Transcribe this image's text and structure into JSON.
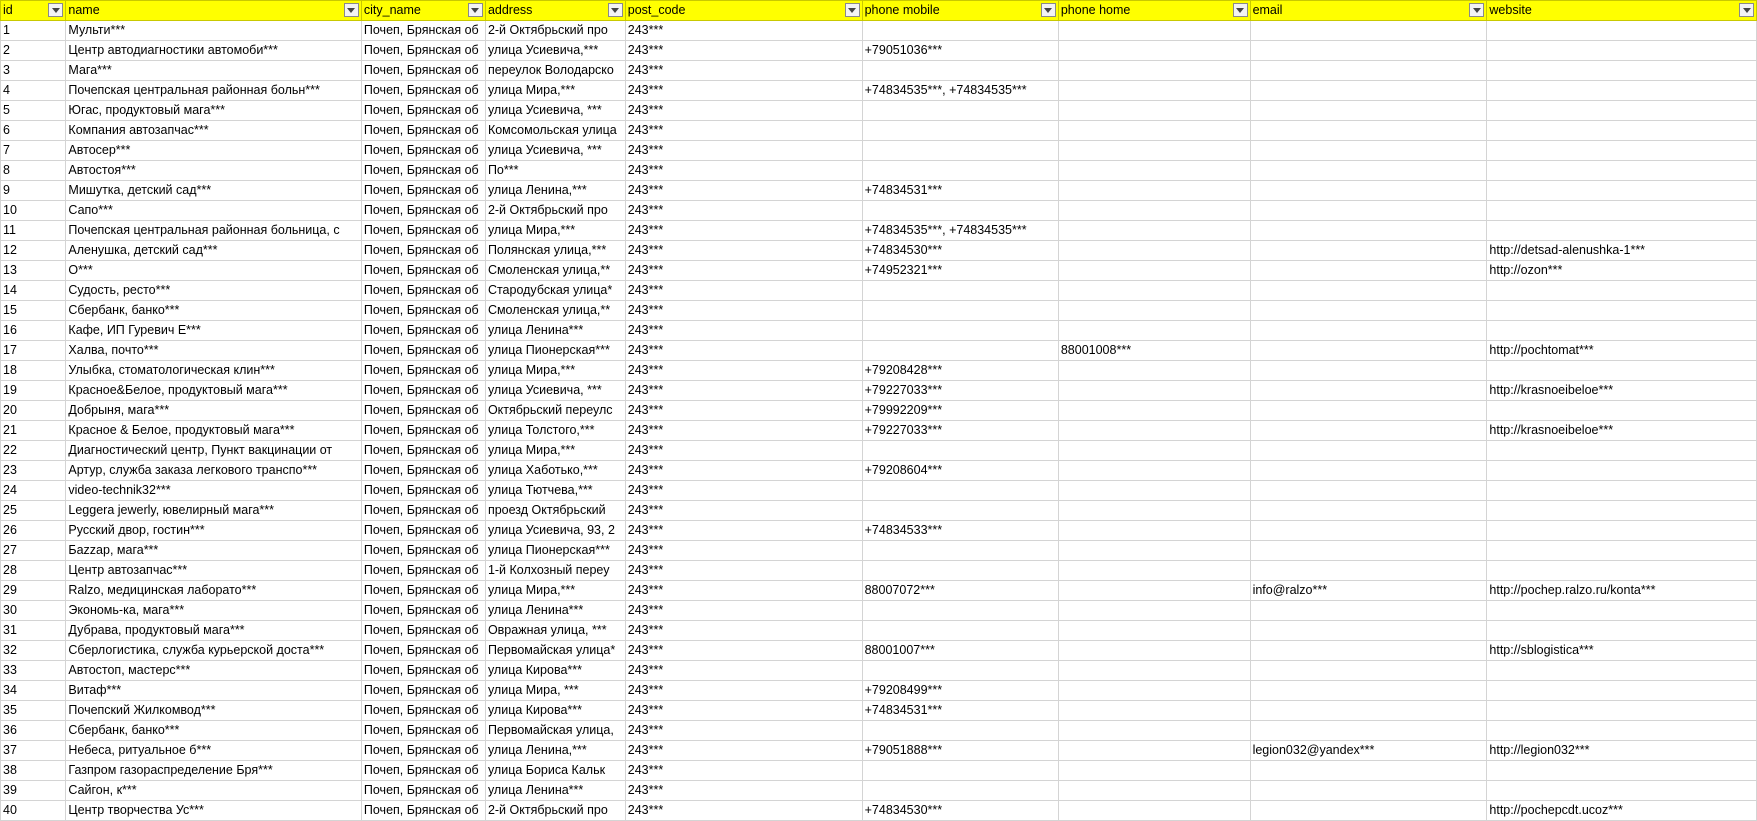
{
  "columns": [
    "id",
    "name",
    "city_name",
    "address",
    "post_code",
    "phone mobile",
    "phone home",
    "email",
    "website"
  ],
  "rows": [
    [
      "1",
      "Мульти***",
      "Почеп, Брянская об",
      "2-й Октябрьский про",
      "243***",
      "",
      "",
      "",
      ""
    ],
    [
      "2",
      "Центр автодиагностики автомоби***",
      "Почеп, Брянская об",
      "улица Усиевича,***",
      "243***",
      "+79051036***",
      "",
      "",
      ""
    ],
    [
      "3",
      "Мага***",
      "Почеп, Брянская об",
      "переулок Володарско",
      "243***",
      "",
      "",
      "",
      ""
    ],
    [
      "4",
      "Почепская центральная районная больн***",
      "Почеп, Брянская об",
      "улица Мира,***",
      "243***",
      "+74834535***, +74834535***",
      "",
      "",
      ""
    ],
    [
      "5",
      "Югас, продуктовый мага***",
      "Почеп, Брянская об",
      "улица Усиевича, ***",
      "243***",
      "",
      "",
      "",
      ""
    ],
    [
      "6",
      "Компания автозапчас***",
      "Почеп, Брянская об",
      "Комсомольская улица",
      "243***",
      "",
      "",
      "",
      ""
    ],
    [
      "7",
      "Автосер***",
      "Почеп, Брянская об",
      "улица Усиевича, ***",
      "243***",
      "",
      "",
      "",
      ""
    ],
    [
      "8",
      "Автостоя***",
      "Почеп, Брянская об",
      "По***",
      "243***",
      "",
      "",
      "",
      ""
    ],
    [
      "9",
      "Мишутка, детский сад***",
      "Почеп, Брянская об",
      "улица Ленина,***",
      "243***",
      "+74834531***",
      "",
      "",
      ""
    ],
    [
      "10",
      "Сапо***",
      "Почеп, Брянская об",
      "2-й Октябрьский про",
      "243***",
      "",
      "",
      "",
      ""
    ],
    [
      "11",
      "Почепская центральная районная больница, с",
      "Почеп, Брянская об",
      "улица Мира,***",
      "243***",
      "+74834535***, +74834535***",
      "",
      "",
      ""
    ],
    [
      "12",
      "Аленушка, детский сад***",
      "Почеп, Брянская об",
      "Полянская улица,***",
      "243***",
      "+74834530***",
      "",
      "",
      "http://detsad-alenushka-1***"
    ],
    [
      "13",
      "О***",
      "Почеп, Брянская об",
      "Смоленская улица,**",
      "243***",
      "+74952321***",
      "",
      "",
      "http://ozon***"
    ],
    [
      "14",
      "Судость, ресто***",
      "Почеп, Брянская об",
      "Стародубская улица*",
      "243***",
      "",
      "",
      "",
      ""
    ],
    [
      "15",
      "Сбербанк, банко***",
      "Почеп, Брянская об",
      "Смоленская улица,**",
      "243***",
      "",
      "",
      "",
      ""
    ],
    [
      "16",
      "Кафе, ИП Гуревич Е***",
      "Почеп, Брянская об",
      "улица Ленина***",
      "243***",
      "",
      "",
      "",
      ""
    ],
    [
      "17",
      "Халва, почто***",
      "Почеп, Брянская об",
      "улица Пионерская***",
      "243***",
      "",
      "88001008***",
      "",
      "http://pochtomat***"
    ],
    [
      "18",
      "Улыбка, стоматологическая клин***",
      "Почеп, Брянская об",
      "улица Мира,***",
      "243***",
      "+79208428***",
      "",
      "",
      ""
    ],
    [
      "19",
      "Красное&Белое, продуктовый мага***",
      "Почеп, Брянская об",
      "улица Усиевича, ***",
      "243***",
      "+79227033***",
      "",
      "",
      "http://krasnoeibeloe***"
    ],
    [
      "20",
      "Добрыня, мага***",
      "Почеп, Брянская об",
      "Октябрьский переулс",
      "243***",
      "+79992209***",
      "",
      "",
      ""
    ],
    [
      "21",
      "Красное & Белое, продуктовый мага***",
      "Почеп, Брянская об",
      "улица Толстого,***",
      "243***",
      "+79227033***",
      "",
      "",
      "http://krasnoeibeloe***"
    ],
    [
      "22",
      "Диагностический центр, Пункт вакцинации от",
      "Почеп, Брянская об",
      "улица Мира,***",
      "243***",
      "",
      "",
      "",
      ""
    ],
    [
      "23",
      "Артур, служба заказа легкового транспо***",
      "Почеп, Брянская об",
      "улица Хаботько,***",
      "243***",
      "+79208604***",
      "",
      "",
      ""
    ],
    [
      "24",
      "video-technik32***",
      "Почеп, Брянская об",
      "улица Тютчева,***",
      "243***",
      "",
      "",
      "",
      ""
    ],
    [
      "25",
      "Leggera jewerly, ювелирный мага***",
      "Почеп, Брянская об",
      "проезд Октябрьский",
      "243***",
      "",
      "",
      "",
      ""
    ],
    [
      "26",
      "Русский двор, гостин***",
      "Почеп, Брянская об",
      "улица Усиевича, 93, 2",
      "243***",
      "+74834533***",
      "",
      "",
      ""
    ],
    [
      "27",
      "Баzzар, мага***",
      "Почеп, Брянская об",
      "улица Пионерская***",
      "243***",
      "",
      "",
      "",
      ""
    ],
    [
      "28",
      "Центр автозапчас***",
      "Почеп, Брянская об",
      "1-й Колхозный переу",
      "243***",
      "",
      "",
      "",
      ""
    ],
    [
      "29",
      "Ralzo, медицинская лаборато***",
      "Почеп, Брянская об",
      "улица Мира,***",
      "243***",
      "88007072***",
      "",
      "info@ralzo***",
      "http://pochep.ralzo.ru/konta***"
    ],
    [
      "30",
      "Экономь-ка, мага***",
      "Почеп, Брянская об",
      "улица Ленина***",
      "243***",
      "",
      "",
      "",
      ""
    ],
    [
      "31",
      "Дубрава, продуктовый мага***",
      "Почеп, Брянская об",
      "Овражная улица, ***",
      "243***",
      "",
      "",
      "",
      ""
    ],
    [
      "32",
      "Сберлогистика, служба курьерской доста***",
      "Почеп, Брянская об",
      "Первомайская улица*",
      "243***",
      "88001007***",
      "",
      "",
      "http://sblogistica***"
    ],
    [
      "33",
      "Автостоп, мастерс***",
      "Почеп, Брянская об",
      "улица Кирова***",
      "243***",
      "",
      "",
      "",
      ""
    ],
    [
      "34",
      "Витаф***",
      "Почеп, Брянская об",
      "улица Мира, ***",
      "243***",
      "+79208499***",
      "",
      "",
      ""
    ],
    [
      "35",
      "Почепский Жилкомвод***",
      "Почеп, Брянская об",
      "улица Кирова***",
      "243***",
      "+74834531***",
      "",
      "",
      ""
    ],
    [
      "36",
      "Сбербанк, банко***",
      "Почеп, Брянская об",
      "Первомайская улица,",
      "243***",
      "",
      "",
      "",
      ""
    ],
    [
      "37",
      "Небеса, ритуальное б***",
      "Почеп, Брянская об",
      "улица Ленина,***",
      "243***",
      "+79051888***",
      "",
      "legion032@yandex***",
      "http://legion032***"
    ],
    [
      "38",
      "Газпром газораспределение Бря***",
      "Почеп, Брянская об",
      "улица Бориса Кальк",
      "243***",
      "",
      "",
      "",
      ""
    ],
    [
      "39",
      "Сайгон, к***",
      "Почеп, Брянская об",
      "улица Ленина***",
      "243***",
      "",
      "",
      "",
      ""
    ],
    [
      "40",
      "Центр творчества Ус***",
      "Почеп, Брянская об",
      "2-й Октябрьский про",
      "243***",
      "+74834530***",
      "",
      "",
      "http://pochepcdt.ucoz***"
    ]
  ],
  "colors": {
    "header_bg": "#ffff00",
    "grid": "#d4d4d4"
  },
  "icons": {
    "filter": "filter-dropdown-icon"
  }
}
